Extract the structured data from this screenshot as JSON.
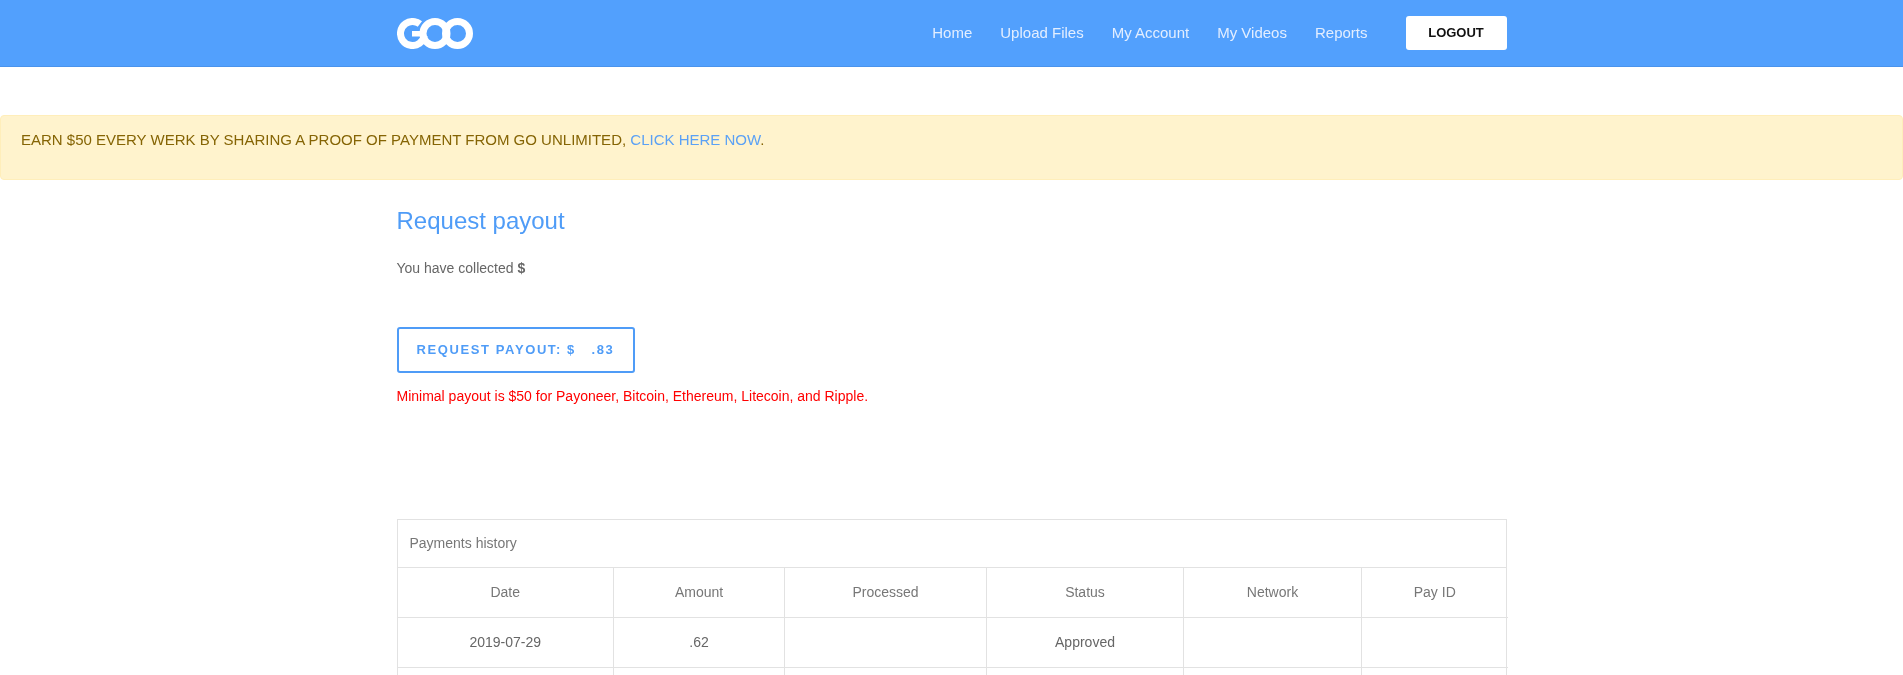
{
  "header": {
    "nav": [
      "Home",
      "Upload Files",
      "My Account",
      "My Videos",
      "Reports"
    ],
    "logout": "LOGOUT"
  },
  "banner": {
    "text": "EARN $50 EVERY WERK BY SHARING A PROOF OF PAYMENT FROM GO UNLIMITED, ",
    "link": "CLICK HERE NOW",
    "after": "."
  },
  "payout": {
    "title": "Request payout",
    "collected": "You have collected **$**",
    "button": "REQUEST PAYOUT: $   .83",
    "note": "Minimal payout is $50 for Payoneer, Bitcoin, Ethereum, Litecoin, and Ripple."
  },
  "payments": {
    "title": "Payments history",
    "columns": [
      "Date",
      "Amount",
      "Processed",
      "Status",
      "Network",
      "Pay ID"
    ],
    "rows": [
      {
        "date": "2019-07-29",
        "amount": ".62",
        "status": "Approved"
      }
    ]
  }
}
